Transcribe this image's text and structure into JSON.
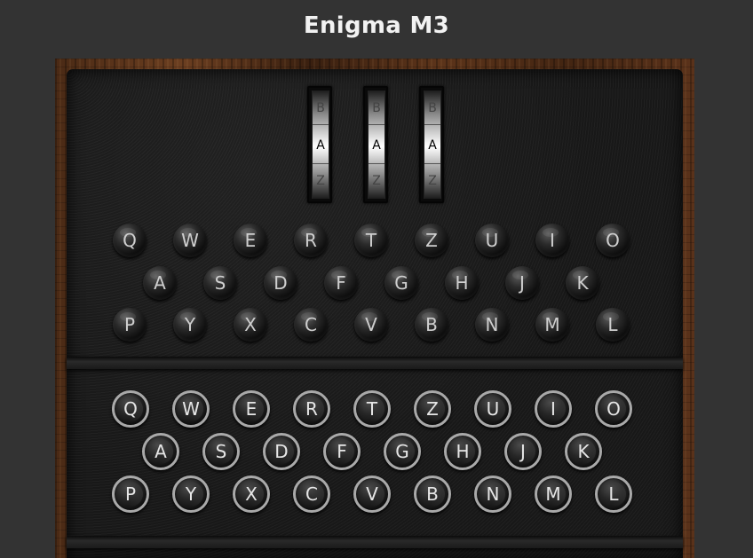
{
  "title": "Enigma M3",
  "rotors": [
    {
      "prev": "B",
      "current": "A",
      "next": "Z"
    },
    {
      "prev": "B",
      "current": "A",
      "next": "Z"
    },
    {
      "prev": "B",
      "current": "A",
      "next": "Z"
    }
  ],
  "lampboard": {
    "rows": [
      [
        "Q",
        "W",
        "E",
        "R",
        "T",
        "Z",
        "U",
        "I",
        "O"
      ],
      [
        "A",
        "S",
        "D",
        "F",
        "G",
        "H",
        "J",
        "K"
      ],
      [
        "P",
        "Y",
        "X",
        "C",
        "V",
        "B",
        "N",
        "M",
        "L"
      ]
    ]
  },
  "keyboard": {
    "rows": [
      [
        "Q",
        "W",
        "E",
        "R",
        "T",
        "Z",
        "U",
        "I",
        "O"
      ],
      [
        "A",
        "S",
        "D",
        "F",
        "G",
        "H",
        "J",
        "K"
      ],
      [
        "P",
        "Y",
        "X",
        "C",
        "V",
        "B",
        "N",
        "M",
        "L"
      ]
    ]
  },
  "colors": {
    "background": "#333333",
    "panel": "#181818",
    "key_ring": "#a9a9a9",
    "title": "#f2f2f2"
  }
}
